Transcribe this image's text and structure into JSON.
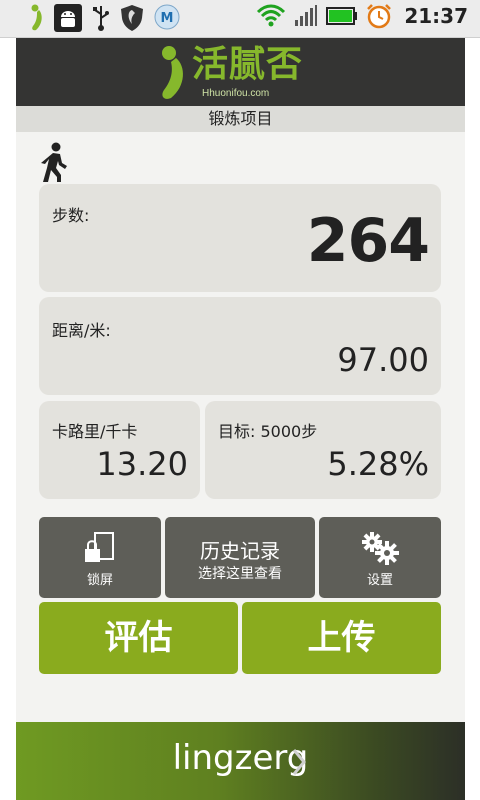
{
  "status_bar": {
    "time": "21:37",
    "icons": [
      "app-foot-icon",
      "android-debug-icon",
      "usb-icon",
      "security-shield-icon",
      "m-app-icon",
      "wifi-icon",
      "signal-icon",
      "battery-icon",
      "alarm-icon"
    ]
  },
  "app": {
    "logo_text": "活腻否",
    "logo_subtext": "Hhuonifou.com",
    "section_title": "锻炼项目",
    "activity_icon": "walking-person-icon"
  },
  "stats": {
    "steps_label": "步数:",
    "steps_value": "264",
    "distance_label": "距离/米:",
    "distance_value": "97.00",
    "calories_label": "卡路里/千卡",
    "calories_value": "13.20",
    "goal_label": "目标: 5000步",
    "goal_value": "5.28%"
  },
  "actions": {
    "lock_label": "锁屏",
    "history_title": "历史记录",
    "history_subtitle": "选择这里查看",
    "settings_label": "设置",
    "evaluate_label": "评估",
    "upload_label": "上传"
  },
  "user": {
    "name": "lingzerg"
  },
  "colors": {
    "brand_green": "#8aab1e",
    "logo_green": "#86b82c",
    "dark_button": "#5e5e58",
    "card_bg": "#e3e2dd",
    "header_bg": "#343433"
  }
}
